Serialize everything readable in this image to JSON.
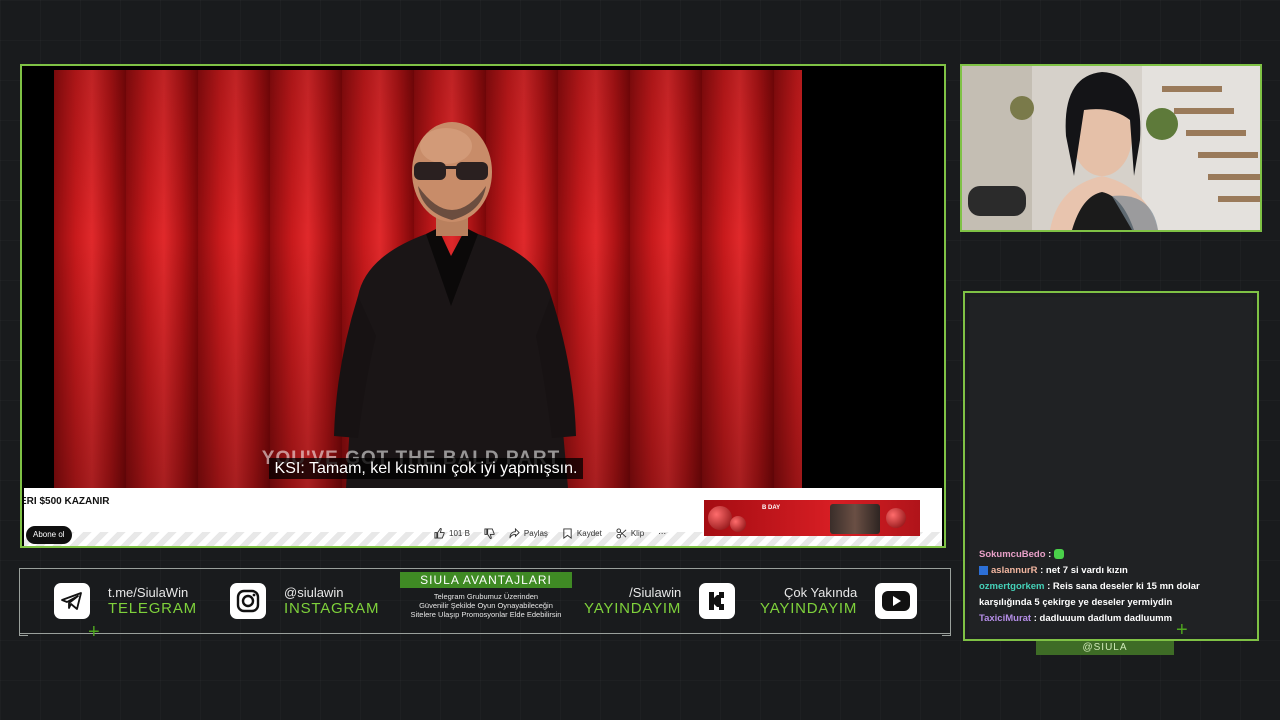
{
  "video": {
    "subtitle_burned": "YOU'VE GOT THE BALD PART",
    "subtitle_translation": "KSI: Tamam, kel kısmını çok iyi yapmışsın."
  },
  "page": {
    "video_title": "ERI $500 KAZANIR",
    "subscribe_label": "Abone ol",
    "like_count": "101 B",
    "share_label": "Paylaş",
    "save_label": "Kaydet",
    "clip_label": "Klip",
    "more_label": "⋯",
    "ad_text": "B DAY"
  },
  "chat": {
    "messages": [
      {
        "user": "SokumcuBedo",
        "color": "#e8a0c8",
        "text": ""
      },
      {
        "user": "aslannurR",
        "color": "#f2b6a0",
        "text": "net 7 si vardı kızın",
        "badge": true
      },
      {
        "user": "ozmertgorkem",
        "color": "#45d1b8",
        "text": "Reis sana deseler ki 15 mn dolar karşılığında 5 çekirge ye deseler yermiydin"
      },
      {
        "user": "TaxiciMurat",
        "color": "#b48de6",
        "text": "dadluuum dadlum dadluumm"
      }
    ]
  },
  "channel_tag": "@SIULA",
  "socials": {
    "telegram": {
      "top": "t.me/SiulaWin",
      "bottom": "TELEGRAM",
      "icon": "telegram-icon"
    },
    "instagram": {
      "top": "@siulawin",
      "bottom": "INSTAGRAM",
      "icon": "instagram-icon"
    },
    "kick": {
      "top": "/Siulawin",
      "bottom": "YAYINDAYIM",
      "icon": "kick-icon"
    },
    "youtube": {
      "top": "Çok Yakında",
      "bottom": "YAYINDAYIM",
      "icon": "youtube-icon"
    }
  },
  "advantages": {
    "title": "SIULA AVANTAJLARI",
    "line1": "Telegram Grubumuz Üzerinden",
    "line2": "Güvenilir Şekilde Oyun Oynayabileceğin",
    "line3": "Sitelere Ulaşıp Promosyonlar Elde Edebilirsin"
  },
  "colors": {
    "accent": "#7fc245",
    "accent_text": "#7ed13b",
    "background": "#191b1d"
  }
}
